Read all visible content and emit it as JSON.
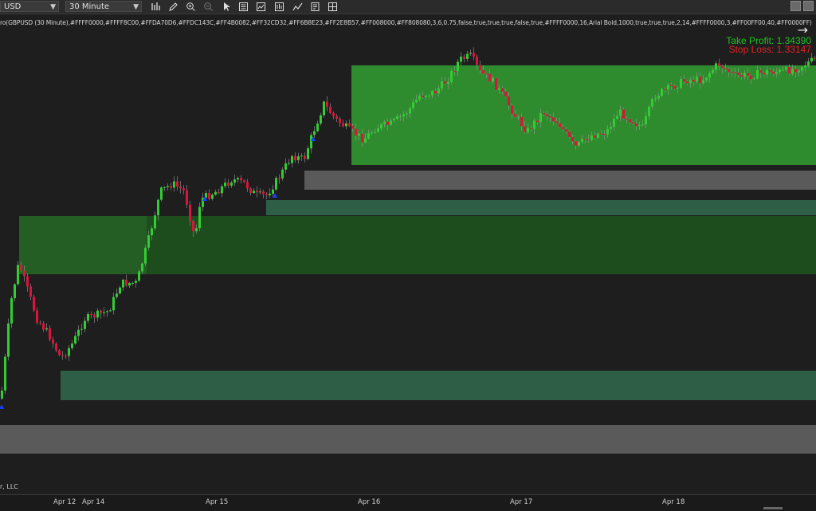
{
  "toolbar": {
    "instrument": "USD",
    "timeframe": "30 Minute",
    "icons": [
      "bar-chart-icon",
      "pencil-icon",
      "zoom-in-icon",
      "zoom-out-icon",
      "pointer-icon",
      "properties-icon",
      "indicators-icon",
      "strategies-icon",
      "drawing-tools-icon",
      "data-box-icon",
      "grid-icon"
    ]
  },
  "indicator_label": "ro(GBPUSD (30 Minute),#FFFF0000,#FFFF8C00,#FFDA70D6,#FFDC143C,#FF4B0082,#FF32CD32,#FF6B8E23,#FF2E8B57,#FF008000,#FF808080,3,6,0.75,false,true,true,true,false,true,#FFFF0000,16,Arial Bold,1000,true,true,true,2,14,#FFFF0000,3,#FF00FF00,40,#FF0000FF)",
  "take_profit": "Take Profit: 1.34390",
  "stop_loss": "Stop Loss: 1.33147",
  "copyright": "r, LLC",
  "x_axis_labels": [
    "Apr 12",
    "Apr 14",
    "Apr 15",
    "Apr 16",
    "Apr 17",
    "Apr 18"
  ],
  "colors": {
    "background": "#1e1e1e",
    "up_candle": "#32cd32",
    "down_candle": "#dc143c",
    "demand_zone": "#2e8b2e",
    "zone_dark_green": "#1d4d1d",
    "zone_teal": "#2e5e46",
    "zone_gray": "#5a5a5a",
    "signal_marker": "#1a3cff",
    "take_profit": "#22c122",
    "stop_loss": "#e22222"
  }
}
